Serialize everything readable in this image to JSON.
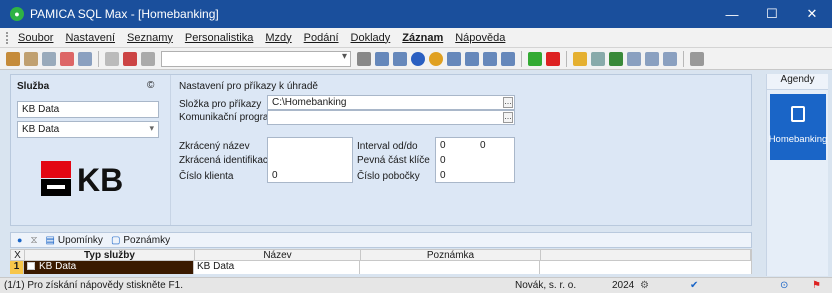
{
  "window": {
    "title": "PAMICA SQL Max - [Homebanking]"
  },
  "menu": [
    "Soubor",
    "Nastavení",
    "Seznamy",
    "Personalistika",
    "Mzdy",
    "Podání",
    "Doklady",
    "Záznam",
    "Nápověda"
  ],
  "left": {
    "sluzba_label": "Služba",
    "sluzba_icon": "©",
    "field1": "KB Data",
    "field2": "KB Data",
    "logo_text": "KB"
  },
  "settings": {
    "heading": "Nastavení pro příkazy k úhradě",
    "slozka_label": "Složka pro příkazy",
    "slozka_value": "C:\\Homebanking",
    "komunikacni_label": "Komunikační program",
    "zkraceny_nazev_label": "Zkrácený název",
    "zkracena_ident_label": "Zkrácená identifikace",
    "cislo_klienta_label": "Číslo klienta",
    "cislo_klienta_value": "0",
    "interval_label": "Interval od/do",
    "interval_from": "0",
    "interval_to": "0",
    "pevna_label": "Pevná část klíče",
    "pevna_value": "0",
    "cislo_pobocky_label": "Číslo pobočky",
    "cislo_pobocky_value": "0"
  },
  "agendy": {
    "header": "Agendy",
    "button": "Homebanking"
  },
  "tabs": [
    "Upomínky",
    "Poznámky"
  ],
  "grid": {
    "headers": [
      "X",
      "Typ služby",
      "Název",
      "Poznámka"
    ],
    "rows": [
      {
        "num": "1",
        "typ": "KB Data",
        "nazev": "KB Data",
        "poznamka": ""
      }
    ]
  },
  "status": {
    "help": "(1/1) Pro získání nápovědy stiskněte F1.",
    "company": "Novák, s. r. o.",
    "year": "2024"
  },
  "colors": {
    "titlebar": "#1a4f9c",
    "accent": "#1a65c7",
    "selection": "#3a1a00",
    "kb_red": "#e30613"
  }
}
